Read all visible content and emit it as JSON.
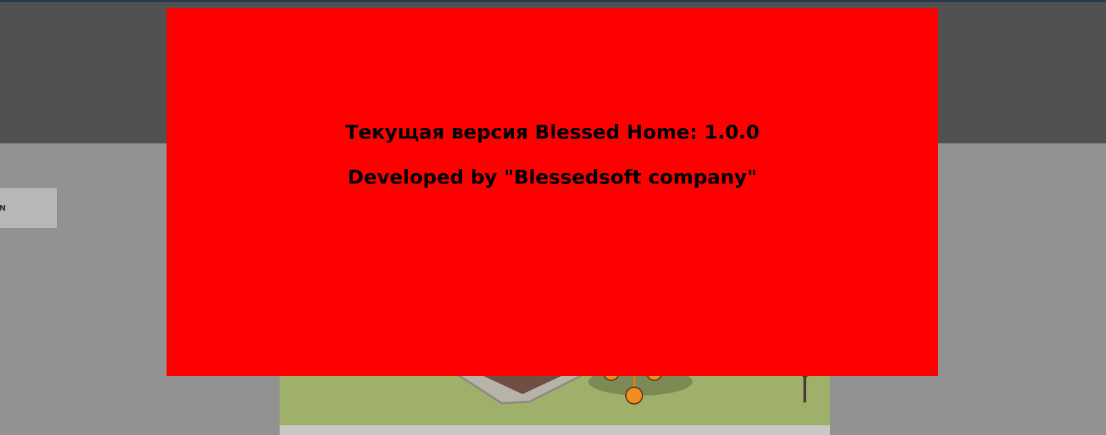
{
  "background": {
    "left_button_label": "N"
  },
  "about_dialog": {
    "version_line": "Текущая версия Blessed Home: 1.0.0",
    "developer_line": "Developed by \"Blessedsoft company\""
  },
  "colors": {
    "dialog_background": "#ff0000",
    "header_band": "#515151",
    "page_background": "#929292",
    "top_line": "#2a3a4e"
  },
  "icons": [
    "night-mode-icon",
    "crown-icon",
    "thermometer-icon"
  ]
}
